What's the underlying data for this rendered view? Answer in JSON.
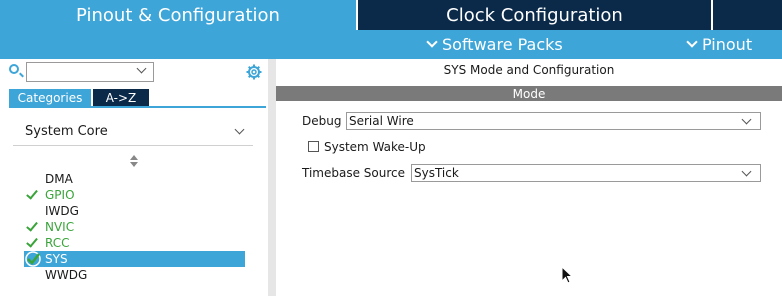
{
  "tabs": {
    "pinout": "Pinout & Configuration",
    "clock": "Clock Configuration"
  },
  "subbar": {
    "software_packs": "Software Packs",
    "pinout": "Pinout"
  },
  "sidebar": {
    "search_value": "",
    "tab_categories": "Categories",
    "tab_az": "A->Z",
    "group": "System Core",
    "items": [
      {
        "label": "DMA",
        "status": "none"
      },
      {
        "label": "GPIO",
        "status": "ok"
      },
      {
        "label": "IWDG",
        "status": "none"
      },
      {
        "label": "NVIC",
        "status": "ok"
      },
      {
        "label": "RCC",
        "status": "ok"
      },
      {
        "label": "SYS",
        "status": "selected-ok"
      },
      {
        "label": "WWDG",
        "status": "none"
      }
    ]
  },
  "main": {
    "title": "SYS Mode and Configuration",
    "section": "Mode",
    "debug_label": "Debug",
    "debug_value": "Serial Wire",
    "wakeup_label": "System Wake-Up",
    "wakeup_checked": false,
    "timebase_label": "Timebase Source",
    "timebase_value": "SysTick"
  },
  "colors": {
    "accent": "#3ea5d8",
    "dark_tab": "#0b2a4a",
    "ok_green": "#3aa43a",
    "mode_bar": "#7a7a7a"
  },
  "icons": [
    "search-icon",
    "gear-icon",
    "chevron-down-icon",
    "sort-icon",
    "check-icon",
    "mouse-cursor-icon"
  ]
}
